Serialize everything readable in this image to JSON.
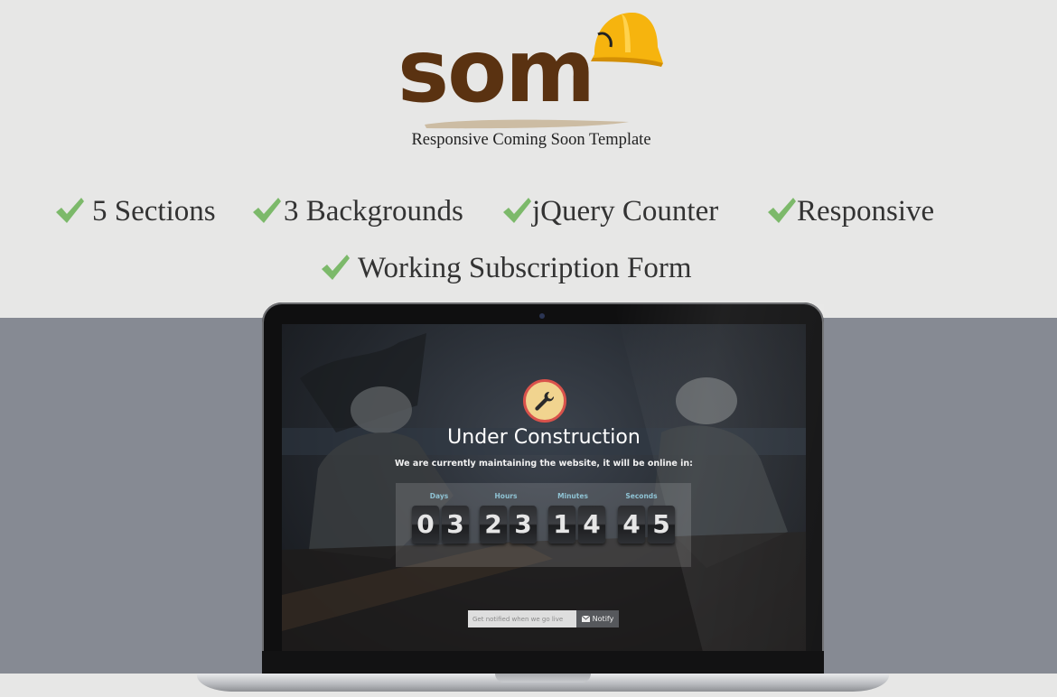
{
  "logo": {
    "wordmark": "SOM",
    "tagline": "Responsive Coming Soon Template",
    "colors": {
      "brown": "#5a3211",
      "helmet": "#f6b40e",
      "brush": "#c9b79b"
    }
  },
  "features": [
    {
      "label": "5 Sections",
      "icon": "check-icon"
    },
    {
      "label": "3 Backgrounds",
      "icon": "check-icon"
    },
    {
      "label": "jQuery Counter",
      "icon": "check-icon"
    },
    {
      "label": "Responsive",
      "icon": "check-icon"
    },
    {
      "label": "Working Subscription Form",
      "icon": "check-icon"
    }
  ],
  "accent_check": "#7cb96a",
  "screen": {
    "icon": "wrench-icon",
    "title": "Under Construction",
    "subtitle": "We are currently maintaining the website, it will be online in:",
    "countdown": {
      "labels": [
        "Days",
        "Hours",
        "Minutes",
        "Seconds"
      ],
      "digits": [
        "0",
        "3",
        "2",
        "3",
        "1",
        "4",
        "4",
        "5"
      ]
    },
    "subscribe": {
      "placeholder": "Get notified when we go live",
      "button_label": "Notify",
      "button_icon": "envelope-icon"
    }
  }
}
